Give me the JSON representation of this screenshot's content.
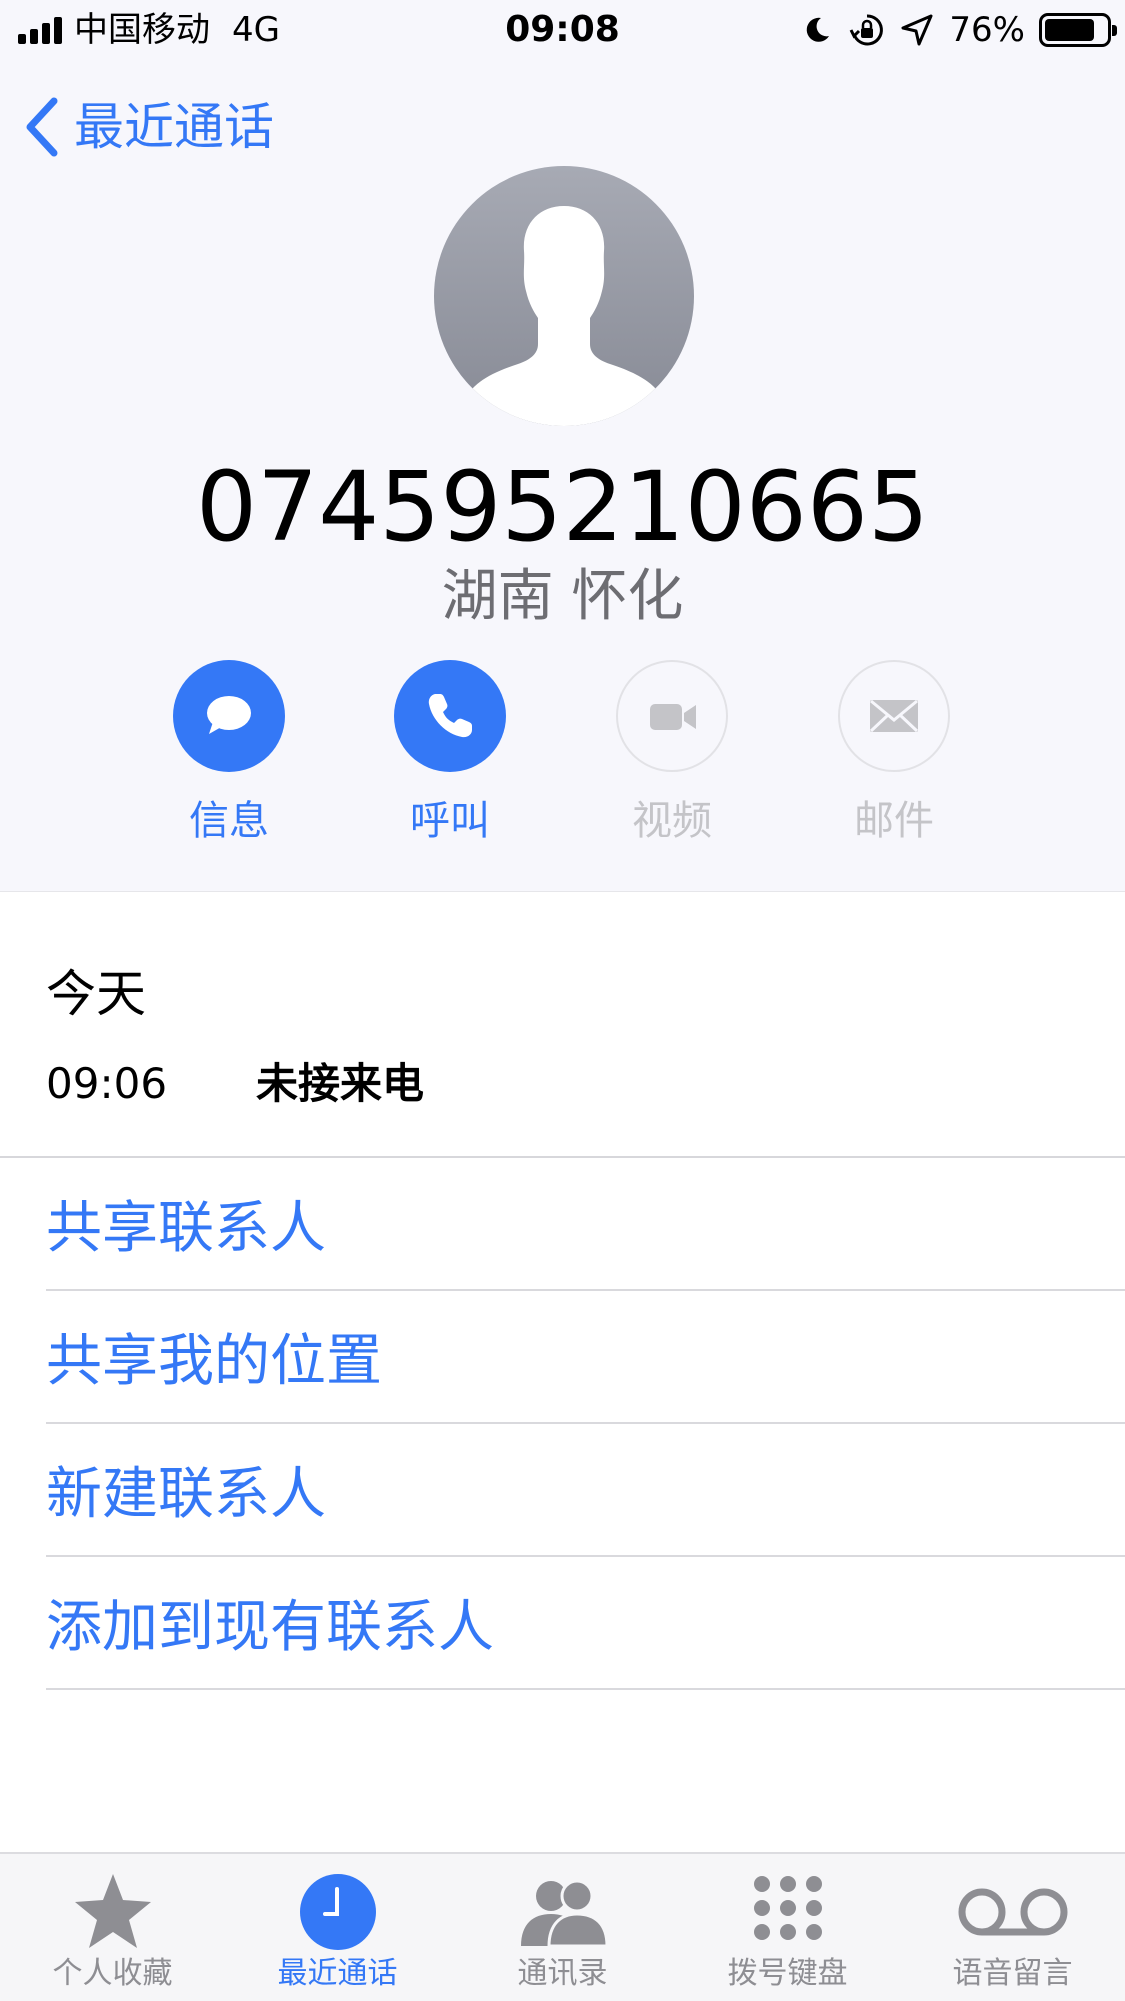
{
  "status_bar": {
    "carrier": "中国移动",
    "network": "4G",
    "time": "09:08",
    "battery_percent": "76%",
    "icons": [
      "moon-icon",
      "orientation-lock-icon",
      "location-arrow-icon"
    ]
  },
  "nav": {
    "back_label": "最近通话"
  },
  "contact": {
    "phone_number": "074595210665",
    "location": "湖南 怀化"
  },
  "actions": [
    {
      "label": "信息",
      "icon": "message-icon",
      "enabled": true
    },
    {
      "label": "呼叫",
      "icon": "phone-icon",
      "enabled": true
    },
    {
      "label": "视频",
      "icon": "video-icon",
      "enabled": false
    },
    {
      "label": "邮件",
      "icon": "mail-icon",
      "enabled": false
    }
  ],
  "history": {
    "date_label": "今天",
    "entries": [
      {
        "time": "09:06",
        "type": "未接来电"
      }
    ]
  },
  "options": [
    "共享联系人",
    "共享我的位置",
    "新建联系人",
    "添加到现有联系人"
  ],
  "tab_bar": {
    "selected": "最近通话",
    "tabs": [
      {
        "label": "个人收藏",
        "icon": "star-icon"
      },
      {
        "label": "最近通话",
        "icon": "clock-icon"
      },
      {
        "label": "通讯录",
        "icon": "contacts-icon"
      },
      {
        "label": "拨号键盘",
        "icon": "keypad-icon"
      },
      {
        "label": "语音留言",
        "icon": "voicemail-icon"
      }
    ]
  },
  "colors": {
    "accent": "#3478f6",
    "disabled": "#c4c4c8",
    "secondary_text": "#6d6d72"
  }
}
